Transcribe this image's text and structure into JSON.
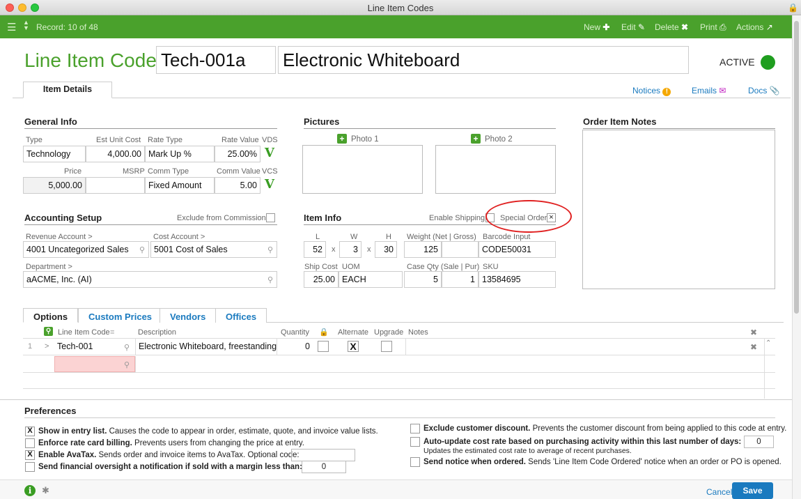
{
  "window": {
    "title": "Line Item Codes"
  },
  "toolbar": {
    "record": "Record: 10 of 48",
    "new": "New",
    "edit": "Edit",
    "delete": "Delete",
    "print": "Print",
    "actions": "Actions"
  },
  "header": {
    "label": "Line Item Code:",
    "code": "Tech-001a",
    "description": "Electronic Whiteboard",
    "status": "ACTIVE"
  },
  "tabs_top": {
    "item_details": "Item Details",
    "notices": "Notices",
    "emails": "Emails",
    "docs": "Docs"
  },
  "general": {
    "title": "General Info",
    "type_label": "Type",
    "type": "Technology",
    "est_label": "Est Unit Cost",
    "est": "4,000.00",
    "rate_type_label": "Rate Type",
    "rate_type": "Mark Up %",
    "rate_value_label": "Rate Value",
    "rate_value": "25.00%",
    "vds_label": "VDS",
    "price_label": "Price",
    "price": "5,000.00",
    "msrp_label": "MSRP",
    "msrp": "",
    "comm_type_label": "Comm Type",
    "comm_type": "Fixed Amount",
    "comm_value_label": "Comm Value",
    "comm_value": "5.00",
    "vcs_label": "VCS",
    "v": "V"
  },
  "pictures": {
    "title": "Pictures",
    "photo1": "Photo 1",
    "photo2": "Photo 2"
  },
  "notes": {
    "title": "Order Item Notes"
  },
  "accounting": {
    "title": "Accounting Setup",
    "exclude": "Exclude from Commissions",
    "revenue_label": "Revenue Account >",
    "revenue": "4001 Uncategorized Sales",
    "cost_label": "Cost Account >",
    "cost": "5001 Cost of Sales",
    "dept_label": "Department >",
    "dept": "aACME, Inc. (AI)"
  },
  "iteminfo": {
    "title": "Item Info",
    "shipping": "Enable Shipping",
    "special": "Special Order",
    "special_mark": "×",
    "l_label": "L",
    "l": "52",
    "w_label": "W",
    "w": "3",
    "h_label": "H",
    "h": "30",
    "x": "x",
    "weight_label": "Weight (Net | Gross)",
    "weight": "125",
    "barcode_label": "Barcode Input",
    "barcode": "CODE50031",
    "shipcost_label": "Ship Cost",
    "shipcost": "25.00",
    "uom_label": "UOM",
    "uom": "EACH",
    "caseqty_label": "Case Qty (Sale | Pur)",
    "case_sale": "5",
    "case_pur": "1",
    "sku_label": "SKU",
    "sku": "13584695"
  },
  "options": {
    "tabs": [
      "Options",
      "Custom Prices",
      "Vendors",
      "Offices"
    ],
    "cols": {
      "code": "Line Item Code",
      "desc": "Description",
      "qty": "Quantity",
      "alt": "Alternate",
      "upg": "Upgrade",
      "notes": "Notes"
    },
    "row": {
      "num": "1",
      "arrow": ">",
      "code": "Tech-001",
      "desc": "Electronic Whiteboard, freestanding",
      "qty": "0",
      "alt_mark": "X"
    }
  },
  "prefs": {
    "title": "Preferences",
    "p1b": "Show in entry list.",
    "p1": " Causes the code to appear in order, estimate, quote, and invoice value lists.",
    "p2b": "Enforce rate card billing.",
    "p2": " Prevents users from changing the price at entry.",
    "p3b": "Enable AvaTax.",
    "p3": " Sends order and invoice items to AvaTax. Optional code:",
    "p4b": "Send financial oversight a notification if sold with a margin less than:",
    "p4v": "0",
    "p5b": "Exclude customer discount.",
    "p5": " Prevents the customer discount from being applied to this code at entry.",
    "p6b": "Auto-update cost rate based on purchasing activity within this last number of days:",
    "p6v": "0",
    "p6sub": "Updates the estimated cost rate to average of recent purchases.",
    "p7b": "Send notice when ordered.",
    "p7": " Sends 'Line Item Code Ordered' notice when an order or PO is opened.",
    "x": "X"
  },
  "footer": {
    "cancel": "Cancel",
    "save": "Save"
  },
  "colors": {
    "brand": "#4aa12c",
    "link": "#1a7abf",
    "annotation": "#e02020"
  }
}
